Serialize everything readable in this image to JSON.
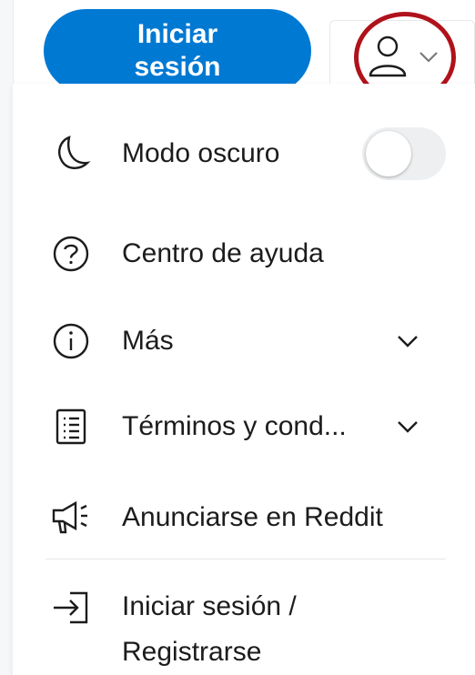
{
  "header": {
    "login_button_label": "Iniciar sesión",
    "user_icon": "person-icon",
    "chevron_icon": "chevron-down-icon"
  },
  "menu": {
    "dark_mode": {
      "label": "Modo oscuro",
      "icon": "moon-icon",
      "enabled": false
    },
    "help_center": {
      "label": "Centro de ayuda",
      "icon": "question-circle-icon"
    },
    "more": {
      "label": "Más",
      "icon": "info-circle-icon"
    },
    "terms": {
      "label": "Términos y cond...",
      "icon": "document-list-icon"
    },
    "advertise": {
      "label": "Anunciarse en Reddit",
      "icon": "megaphone-icon"
    },
    "login_register": {
      "label": "Iniciar sesión / Registrarse",
      "icon": "login-arrow-icon"
    }
  },
  "colors": {
    "brand_blue": "#0079d3",
    "highlight_red": "#b0121b",
    "text": "#1c1c1c",
    "toggle_off": "#edeff1"
  }
}
